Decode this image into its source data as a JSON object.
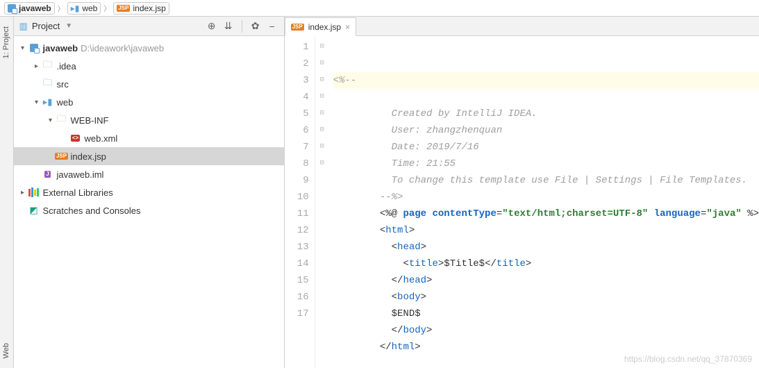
{
  "breadcrumb": [
    {
      "label": "javaweb",
      "icon": "module"
    },
    {
      "label": "web",
      "icon": "folder-open"
    },
    {
      "label": "index.jsp",
      "icon": "jsp"
    }
  ],
  "left_rail": {
    "project_label": "1: Project",
    "web_label": "Web"
  },
  "panel": {
    "title": "Project",
    "tools": {
      "locate": "⊕",
      "collapse": "⇊",
      "settings": "✿",
      "hide": "−"
    }
  },
  "tree": {
    "root": {
      "label": "javaweb",
      "path": "D:\\ideawork\\javaweb"
    },
    "idea": ".idea",
    "src": "src",
    "web": "web",
    "webinf": "WEB-INF",
    "webxml": "web.xml",
    "indexjsp": "index.jsp",
    "iml": "javaweb.iml",
    "extlib": "External Libraries",
    "scratches": "Scratches and Consoles"
  },
  "tab": {
    "label": "index.jsp"
  },
  "code": {
    "l1": "<%--",
    "l2": "  Created by IntelliJ IDEA.",
    "l3": "  User: zhangzhenquan",
    "l4": "  Date: 2019/7/16",
    "l5": "  Time: 21:55",
    "l6": "  To change this template use File | Settings | File Templates.",
    "l7": "--%>",
    "l8_a": "<%@ ",
    "l8_page": "page",
    "l8_ct_attr": " contentType",
    "l8_eq1": "=",
    "l8_ct_val": "\"text/html;charset=UTF-8\"",
    "l8_lang_attr": " language",
    "l8_eq2": "=",
    "l8_lang_val": "\"java\"",
    "l8_end": " %>",
    "l9_o": "<",
    "l9_t": "html",
    "l9_c": ">",
    "l10_o": "  <",
    "l10_t": "head",
    "l10_c": ">",
    "l11_o": "    <",
    "l11_t": "title",
    "l11_c1": ">",
    "l11_txt": "$Title$",
    "l11_o2": "</",
    "l11_c2": ">",
    "l12_o": "  </",
    "l12_t": "head",
    "l12_c": ">",
    "l13_o": "  <",
    "l13_t": "body",
    "l13_c": ">",
    "l14": "  $END$",
    "l15_o": "  </",
    "l15_t": "body",
    "l15_c": ">",
    "l16_o": "</",
    "l16_t": "html",
    "l16_c": ">"
  },
  "gutter": [
    "1",
    "2",
    "3",
    "4",
    "5",
    "6",
    "7",
    "8",
    "9",
    "10",
    "11",
    "12",
    "13",
    "14",
    "15",
    "16",
    "17"
  ],
  "watermark": "https://blog.csdn.net/qq_37870369"
}
